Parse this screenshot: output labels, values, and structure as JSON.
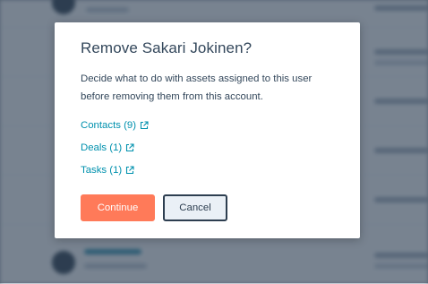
{
  "dialog": {
    "title": "Remove Sakari Jokinen?",
    "description": "Decide what to do with assets assigned to this user before removing them from this account.",
    "assets": [
      {
        "label": "Contacts (9)",
        "icon": "external-link-icon"
      },
      {
        "label": "Deals (1)",
        "icon": "external-link-icon"
      },
      {
        "label": "Tasks (1)",
        "icon": "external-link-icon"
      }
    ],
    "continue_label": "Continue",
    "cancel_label": "Cancel"
  },
  "colors": {
    "primary_button": "#ff7a59",
    "link": "#0091ae",
    "text": "#33475b",
    "overlay": "#2d3e50"
  }
}
